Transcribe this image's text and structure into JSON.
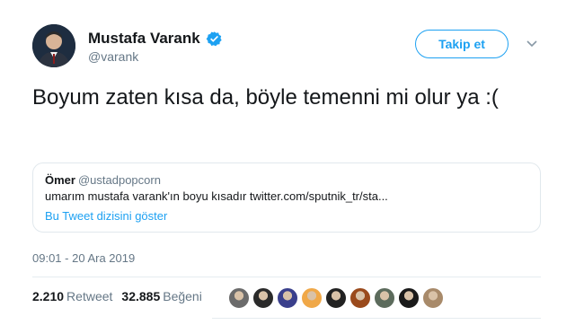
{
  "author": {
    "name": "Mustafa Varank",
    "handle": "@varank",
    "verified": true,
    "avatar_icon": "profile-photo-avatar"
  },
  "actions": {
    "follow_label": "Takip et",
    "menu_icon": "chevron-down-icon"
  },
  "tweet": {
    "text": "Boyum zaten kısa da, böyle temenni mi olur ya :(",
    "timestamp": "09:01 - 20 Ara 2019"
  },
  "quoted": {
    "name": "Ömer",
    "handle": "@ustadpopcorn",
    "text": "umarım mustafa varank'ın boyu kısadır twitter.com/sputnik_tr/sta...",
    "thread_link": "Bu Tweet dizisini göster"
  },
  "stats": {
    "retweets_count": "2.210",
    "retweets_label": "Retweet",
    "likes_count": "32.885",
    "likes_label": "Beğeni"
  },
  "likers": [
    {
      "color": "#6b6b6b"
    },
    {
      "color": "#2a2a2a"
    },
    {
      "color": "#3a3f8c"
    },
    {
      "color": "#f0a848"
    },
    {
      "color": "#222222"
    },
    {
      "color": "#9a4a1c"
    },
    {
      "color": "#5c6b5c"
    },
    {
      "color": "#1a1a1a"
    },
    {
      "color": "#a88a6a"
    }
  ],
  "colors": {
    "accent": "#1da1f2",
    "muted": "#657786",
    "text": "#14171a",
    "border": "#e1e8ed"
  }
}
